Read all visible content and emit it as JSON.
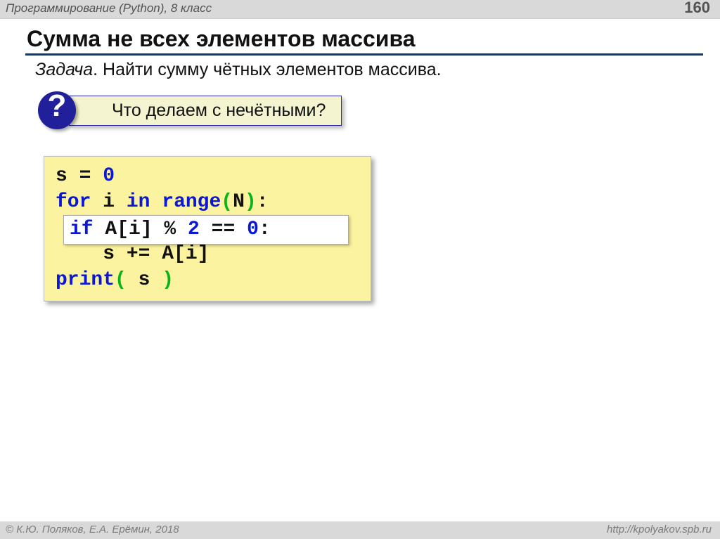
{
  "header": {
    "left": "Программирование (Python), 8 класс",
    "page_number": "160"
  },
  "title": "Сумма не всех элементов массива",
  "task": {
    "label": "Задача",
    "text": ". Найти сумму чётных элементов массива."
  },
  "callout": {
    "mark": "?",
    "text": "Что делаем с нечётными?"
  },
  "code": {
    "line1_a": "s = ",
    "line1_b": "0",
    "line2_a": "for",
    "line2_b": " i ",
    "line2_c": "in",
    "line2_d": " ",
    "line2_e": "range",
    "line2_f": "(",
    "line2_g": "N",
    "line2_h": ")",
    "line2_i": ":",
    "line3_spacer": " ",
    "line4_indent": "    s += A[i]",
    "line5_a": "print",
    "line5_b": "(",
    "line5_c": " s ",
    "line5_d": ")"
  },
  "if_line": {
    "a": "if",
    "b": " A[i] % ",
    "c": "2",
    "d": " == ",
    "e": "0",
    "f": ":"
  },
  "footer": {
    "left": "© К.Ю. Поляков, Е.А. Ерёмин, 2018",
    "right": "http://kpolyakov.spb.ru"
  }
}
